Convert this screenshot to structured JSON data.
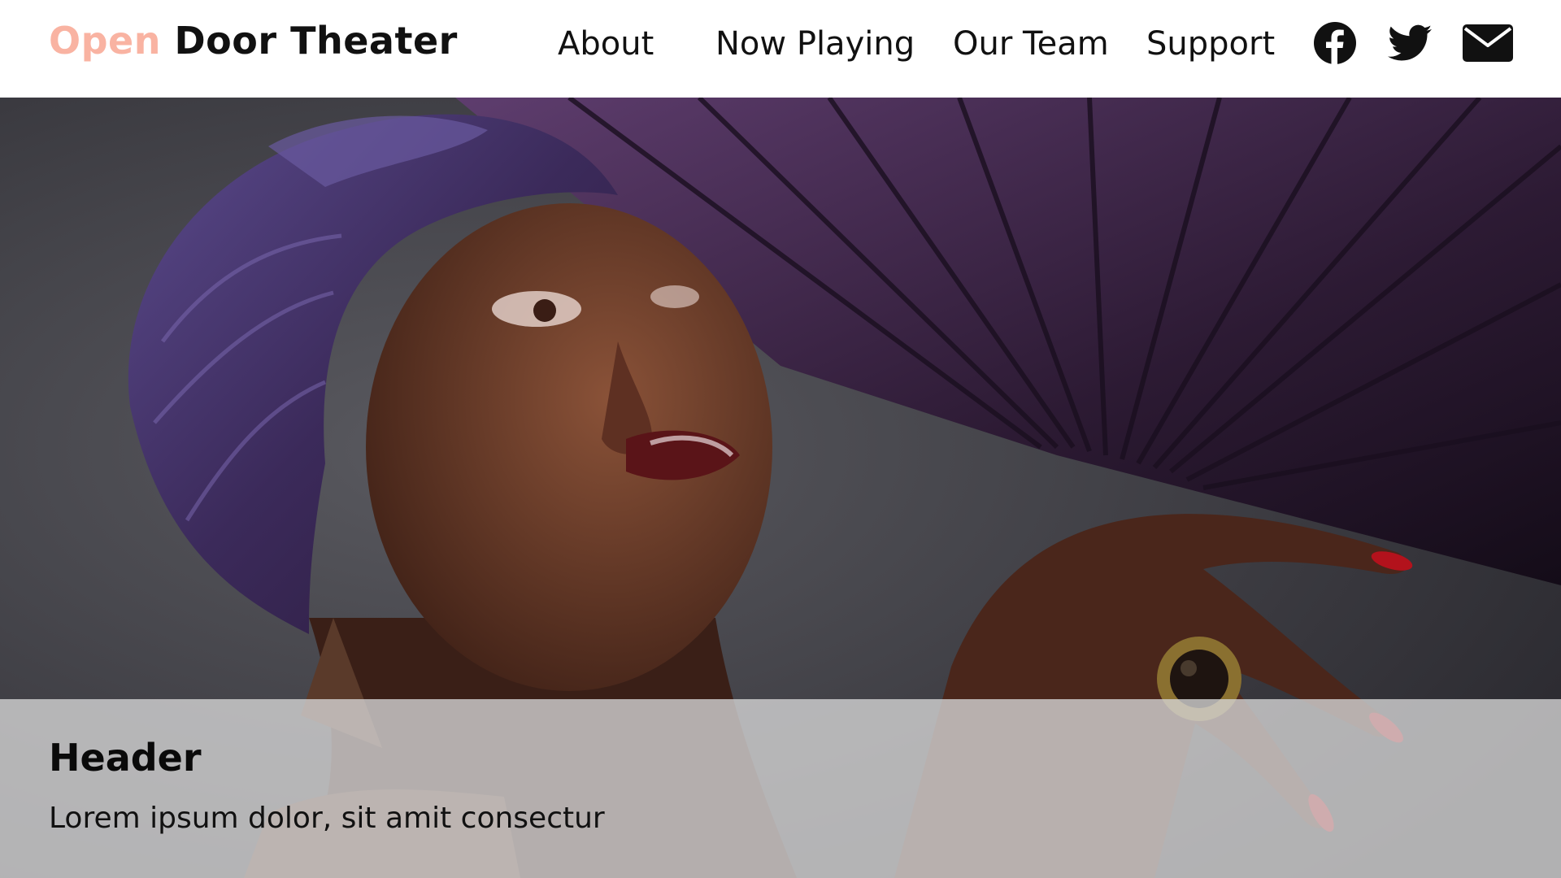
{
  "brand": {
    "first": "Open",
    "rest": " Door Theater",
    "accent_color": "#f9b3a2"
  },
  "nav": {
    "items": [
      {
        "label": "About"
      },
      {
        "label": "Now Playing"
      },
      {
        "label": "Our Team"
      },
      {
        "label": "Support"
      }
    ]
  },
  "social": {
    "icons": [
      "facebook-icon",
      "twitter-icon",
      "envelope-icon"
    ]
  },
  "hero": {
    "image_subject": "portrait-photo",
    "caption": {
      "title": "Header",
      "text": "Lorem ipsum dolor, sit amit consectur"
    }
  }
}
